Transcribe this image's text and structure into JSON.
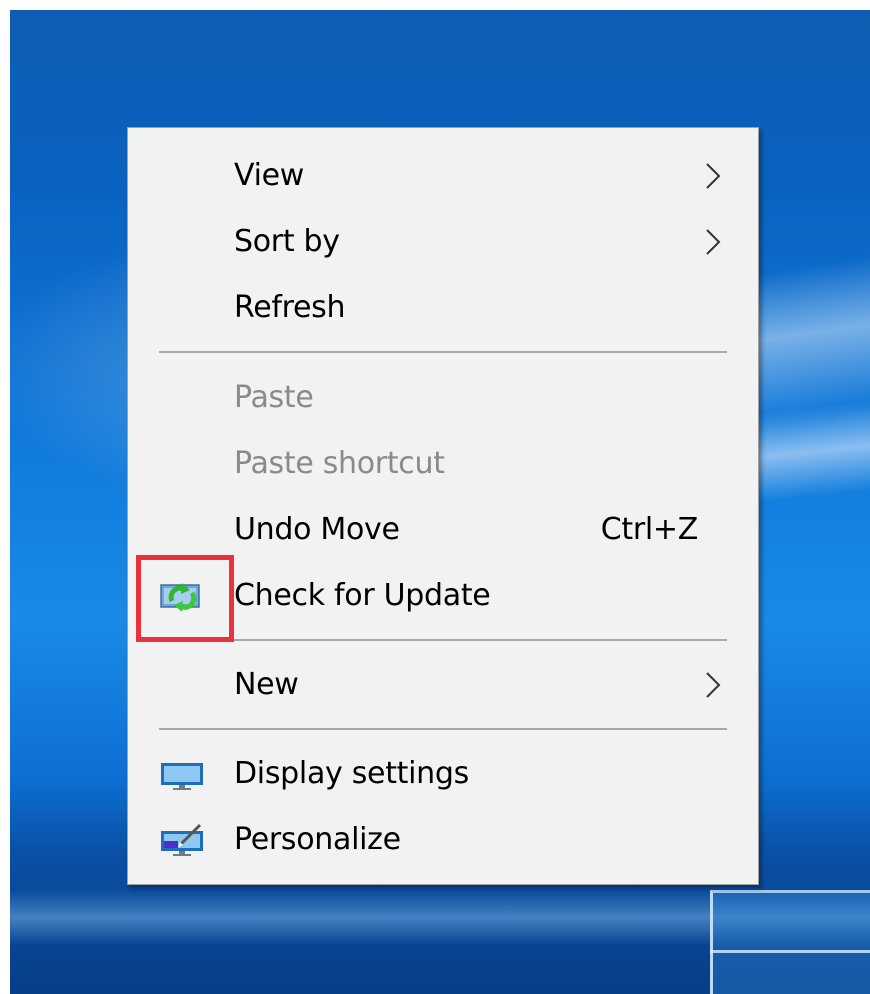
{
  "context_menu": {
    "items": [
      {
        "label": "View",
        "submenu": true
      },
      {
        "label": "Sort by",
        "submenu": true
      },
      {
        "label": "Refresh"
      },
      {
        "label": "Paste",
        "disabled": true
      },
      {
        "label": "Paste shortcut",
        "disabled": true
      },
      {
        "label": "Undo Move",
        "shortcut": "Ctrl+Z"
      },
      {
        "label": "Check for Update",
        "icon": "update-sync-icon"
      },
      {
        "label": "New",
        "submenu": true
      },
      {
        "label": "Display settings",
        "icon": "display-icon"
      },
      {
        "label": "Personalize",
        "icon": "personalize-icon"
      }
    ]
  },
  "colors": {
    "menu_bg": "#f2f2f2",
    "disabled_text": "#8a8a8a",
    "highlight_box": "#e8323c",
    "desktop_blue": "#0e77d8"
  }
}
